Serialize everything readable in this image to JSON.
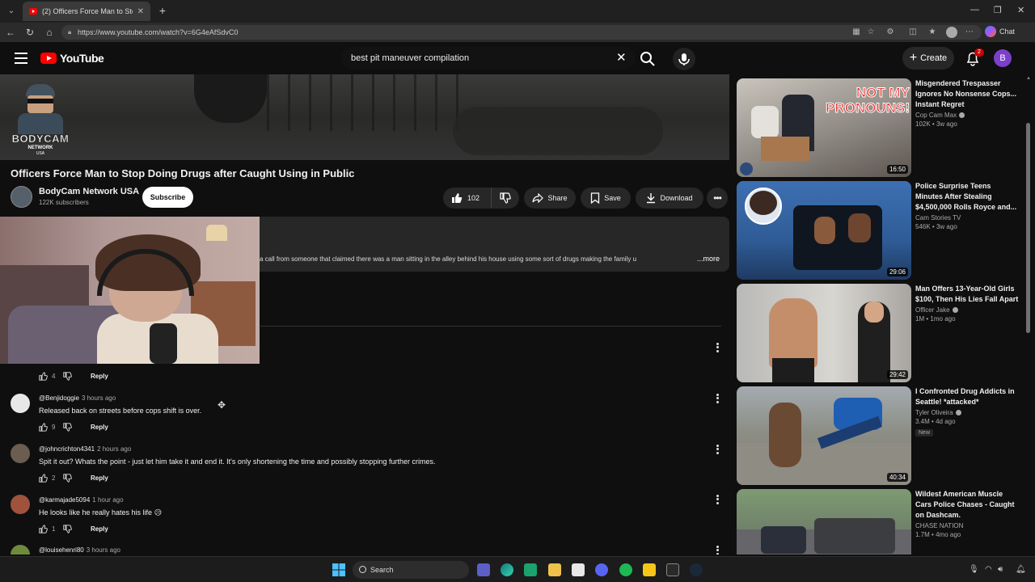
{
  "browser": {
    "tab_title": "(2) Officers Force Man to Stop Doing",
    "url": "https://www.youtube.com/watch?v=6G4eAfSdvC0",
    "copilot_label": "Chat"
  },
  "header": {
    "logo_text": "YouTube",
    "search_value": "best pit maneuver compilation",
    "create_label": "Create",
    "notification_count": "2",
    "account_initial": "B"
  },
  "channel_overlay": {
    "brand": "BODYCAM",
    "line1": "NETWORK",
    "line2": "USA"
  },
  "video": {
    "title": "Officers Force Man to Stop Doing Drugs after Caught Using in Public",
    "channel_name": "BodyCam Network USA",
    "subscribers": "122K subscribers",
    "subscribe_label": "Subscribe",
    "likes": "102",
    "share_label": "Share",
    "save_label": "Save",
    "download_label": "Download",
    "description_snippet": "a call from someone that claimed there was a man sitting in the alley behind his house using some sort of drugs making the family u",
    "more_label": "...more"
  },
  "comments": [
    {
      "author": "",
      "time": "",
      "text": "",
      "likes": "4",
      "reply_label": "Reply"
    },
    {
      "author": "@Benjidoggie",
      "time": "3 hours ago",
      "text": "Released back on streets before cops shift is over.",
      "likes": "9",
      "reply_label": "Reply"
    },
    {
      "author": "@johncrichton4341",
      "time": "2 hours ago",
      "text": "Spit it out?  Whats the point - just let him take it and end it.  It's only shortening the time and possibly stopping further crimes.",
      "likes": "2",
      "reply_label": "Reply"
    },
    {
      "author": "@karmajade5094",
      "time": "1 hour ago",
      "text": "He looks like he really hates his life 😥",
      "likes": "1",
      "reply_label": "Reply"
    },
    {
      "author": "@louisehenri80",
      "time": "3 hours ago",
      "text": "",
      "likes": "",
      "reply_label": ""
    }
  ],
  "recommendations": [
    {
      "title": "Misgendered Trespasser Ignores No Nonsense Cops... Instant Regret",
      "channel": "Cop Cam Max",
      "views": "102K",
      "age": "3w ago",
      "duration": "16:50",
      "thumb_overlay": "NOT MY PRONOUNS!",
      "badge": ""
    },
    {
      "title": "Police Surprise Teens Minutes After Stealing $4,500,000 Rolls Royce and...",
      "channel": "Cam Stories TV",
      "views": "546K",
      "age": "3w ago",
      "duration": "29:06",
      "thumb_overlay": "",
      "badge": ""
    },
    {
      "title": "Man Offers 13-Year-Old Girls $100, Then His Lies Fall Apart",
      "channel": "Officer Jake",
      "views": "1M",
      "age": "1mo ago",
      "duration": "29:42",
      "thumb_overlay": "",
      "badge": ""
    },
    {
      "title": "I Confronted Drug Addicts in Seattle! *attacked*",
      "channel": "Tyler Oliveira",
      "views": "3.4M",
      "age": "4d ago",
      "duration": "40:34",
      "thumb_overlay": "",
      "badge": "New"
    },
    {
      "title": "Wildest American Muscle Cars Police Chases - Caught on Dashcam.",
      "channel": "CHASE NATION",
      "views": "1.7M",
      "age": "4mo ago",
      "duration": "",
      "thumb_overlay": "",
      "badge": ""
    }
  ],
  "taskbar": {
    "search_label": "Search"
  },
  "colors": {
    "brand_red": "#ff0000",
    "background": "#0f0f0f",
    "pill": "#272727",
    "avatar_purple": "#7b3fc9"
  }
}
